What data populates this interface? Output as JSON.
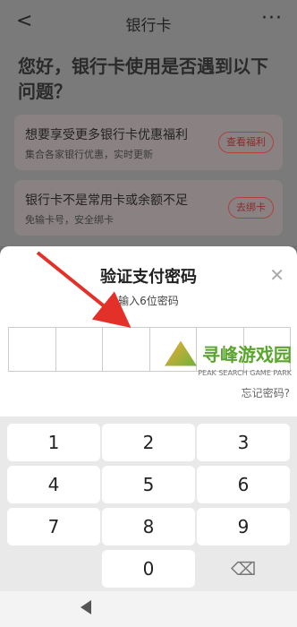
{
  "header": {
    "title": "银行卡",
    "back": "<",
    "more": "···"
  },
  "prompt": {
    "question": "您好，银行卡使用是否遇到以下问题？"
  },
  "cards": [
    {
      "title": "想要享受更多银行卡优惠福利",
      "subtitle": "集合各家银行优惠，实时更新",
      "button": "查看福利"
    },
    {
      "title": "银行卡不是常用卡或余额不足",
      "subtitle": "免输卡号，安全绑卡",
      "button": "去绑卡"
    }
  ],
  "payment_sheet": {
    "title": "验证支付密码",
    "subtitle": "输入6位密码",
    "close": "✕",
    "forgot": "忘记密码?",
    "keys": [
      "1",
      "2",
      "3",
      "4",
      "5",
      "6",
      "7",
      "8",
      "9",
      "",
      "0",
      "⌫"
    ]
  },
  "watermark": {
    "cn": "寻峰游戏园",
    "en": "PEAK SEARCH GAME PARK"
  }
}
